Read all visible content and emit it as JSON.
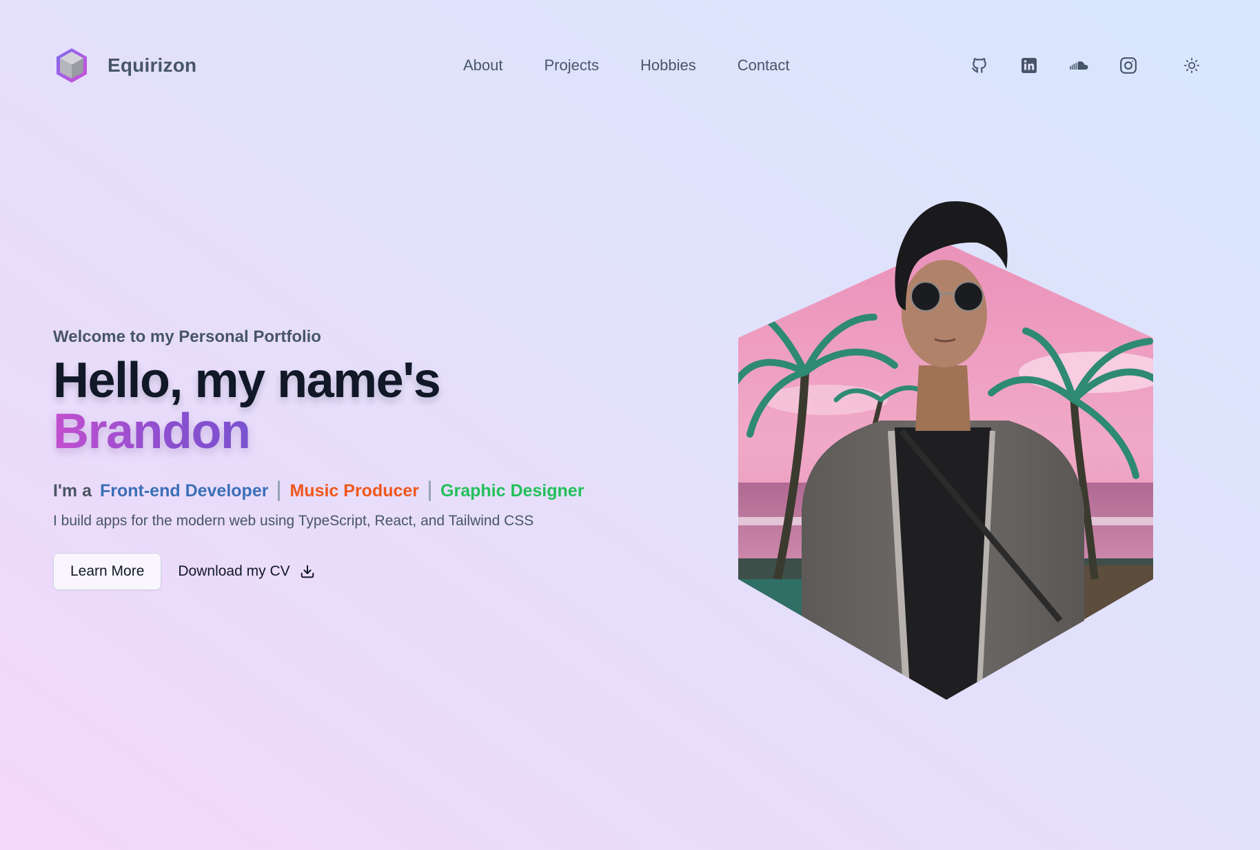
{
  "brand": {
    "name": "Equirizon"
  },
  "nav": {
    "items": [
      {
        "label": "About"
      },
      {
        "label": "Projects"
      },
      {
        "label": "Hobbies"
      },
      {
        "label": "Contact"
      }
    ]
  },
  "socials": [
    "github-icon",
    "linkedin-icon",
    "soundcloud-icon",
    "instagram-icon"
  ],
  "theme_toggle": {
    "icon": "sun-icon"
  },
  "hero": {
    "welcome": "Welcome to my Personal Portfolio",
    "hello": "Hello, my name's",
    "name": "Brandon",
    "roles_prefix": "I'm a",
    "roles": [
      {
        "label": "Front-end Developer",
        "color": "#3b6fb6"
      },
      {
        "label": "Music Producer",
        "color": "#f0571d"
      },
      {
        "label": "Graphic Designer",
        "color": "#22c05a"
      }
    ],
    "tagline": "I build apps for the modern web using TypeScript, React, and Tailwind CSS",
    "learn_more": "Learn More",
    "download_cv": "Download my CV"
  },
  "colors": {
    "name_gradient_start": "#c34fcf",
    "name_gradient_end": "#7a52cf",
    "text_muted": "#475569",
    "heading": "#111827"
  }
}
